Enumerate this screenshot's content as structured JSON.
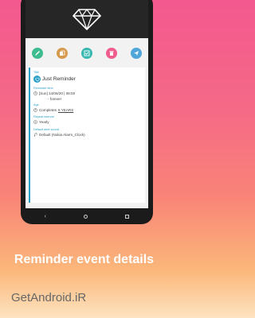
{
  "app_header": {
    "icon": "diamond-icon"
  },
  "action_bar": {
    "buttons": [
      {
        "icon": "pencil-icon",
        "color": "#3dbc8f"
      },
      {
        "icon": "copy-icon",
        "color": "#d79a4d"
      },
      {
        "icon": "checklist-icon",
        "color": "#38b8b0"
      },
      {
        "icon": "trash-icon",
        "color": "#ef5d8c"
      },
      {
        "icon": "send-icon",
        "color": "#4fa6d8"
      }
    ]
  },
  "reminder": {
    "title_label": "Title",
    "title": "Just Reminder",
    "time_label": "Reminder time",
    "time": "[Sun] 14/06/20 | 08:00",
    "repeat_forever": "- forever",
    "age_label": "Age",
    "age_prefix": "Completes",
    "age_value": "6 YEARS",
    "interval_label": "Repeat interval",
    "interval": "Yearly",
    "sound_label": "Default alert sound",
    "sound": "Default (Nokia Alarm_Clock)"
  },
  "nav": {
    "back": "‹"
  },
  "caption": "Reminder event details",
  "watermark": "GetAndroid.iR",
  "colors": {
    "accent": "#2aa0c9"
  }
}
